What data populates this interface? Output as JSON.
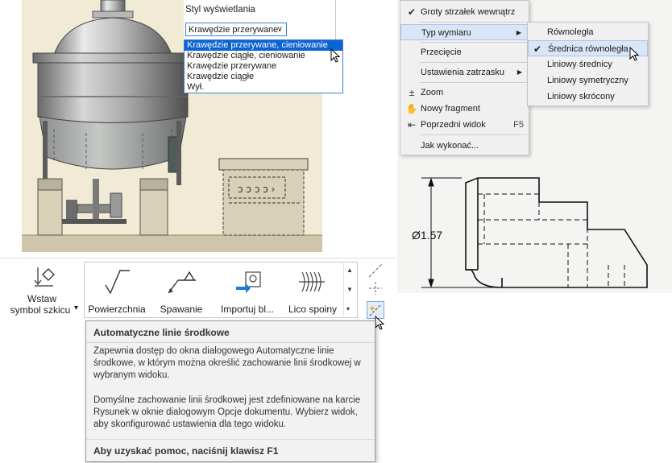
{
  "display_style": {
    "label": "Styl wyświetlania",
    "selected": "Krawędzie przerywane",
    "options": [
      "Krawędzie przerywane, cieniowanie",
      "Krawędzie ciągłe, cieniowanie",
      "Krawędzie przerywane",
      "Krawędzie ciągłe",
      "Wył."
    ],
    "highlighted_index": 0
  },
  "context_menu": {
    "items": [
      {
        "label": "Groty strzałek wewnątrz",
        "icon": "check-icon"
      },
      {
        "label": "Typ wymiaru",
        "submenu": true,
        "highlighted": true
      },
      {
        "label": "Przecięcie"
      },
      {
        "label": "Ustawienia zatrzasku",
        "submenu": true
      },
      {
        "label": "Zoom",
        "icon": "zoom-icon"
      },
      {
        "label": "Nowy fragment",
        "icon": "hand-icon"
      },
      {
        "label": "Poprzedni widok",
        "icon": "previous-view-icon",
        "shortcut": "F5"
      },
      {
        "label": "Jak wykonać..."
      }
    ],
    "submenu_items": [
      {
        "label": "Równoległa"
      },
      {
        "label": "Średnica równoległa",
        "checked": true,
        "highlighted": true
      },
      {
        "label": "Liniowy średnicy"
      },
      {
        "label": "Liniowy symetryczny"
      },
      {
        "label": "Liniowy skrócony"
      }
    ]
  },
  "drawing": {
    "dimension_label": "Ø1.57"
  },
  "ribbon": {
    "sketch_symbol_label_line1": "Wstaw",
    "sketch_symbol_label_line2": "symbol szkicu",
    "dropdown_marker": "▾",
    "gallery": [
      {
        "label": "Powierzchnia",
        "icon": "surface-texture-icon"
      },
      {
        "label": "Spawanie",
        "icon": "welding-symbol-icon"
      },
      {
        "label": "Importuj bl...",
        "icon": "import-block-icon"
      },
      {
        "label": "Lico spoiny",
        "icon": "weld-bead-icon"
      }
    ]
  },
  "tooltip": {
    "title": "Automatyczne linie środkowe",
    "paragraph1": "Zapewnia dostęp do okna dialogowego Automatyczne linie środkowe, w którym można określić zachowanie linii środkowej w wybranym widoku.",
    "paragraph2": "Domyślne zachowanie linii środkowej jest zdefiniowane na karcie Rysunek w oknie dialogowym Opcje dokumentu. Wybierz widok, aby skonfigurować ustawienia dla tego widoku.",
    "help": "Aby uzyskać pomoc, naciśnij klawisz F1"
  },
  "colors": {
    "selection_blue": "#0b63d4",
    "view_background": "#f1ead4",
    "menu_highlight": "#d9e6f7"
  }
}
